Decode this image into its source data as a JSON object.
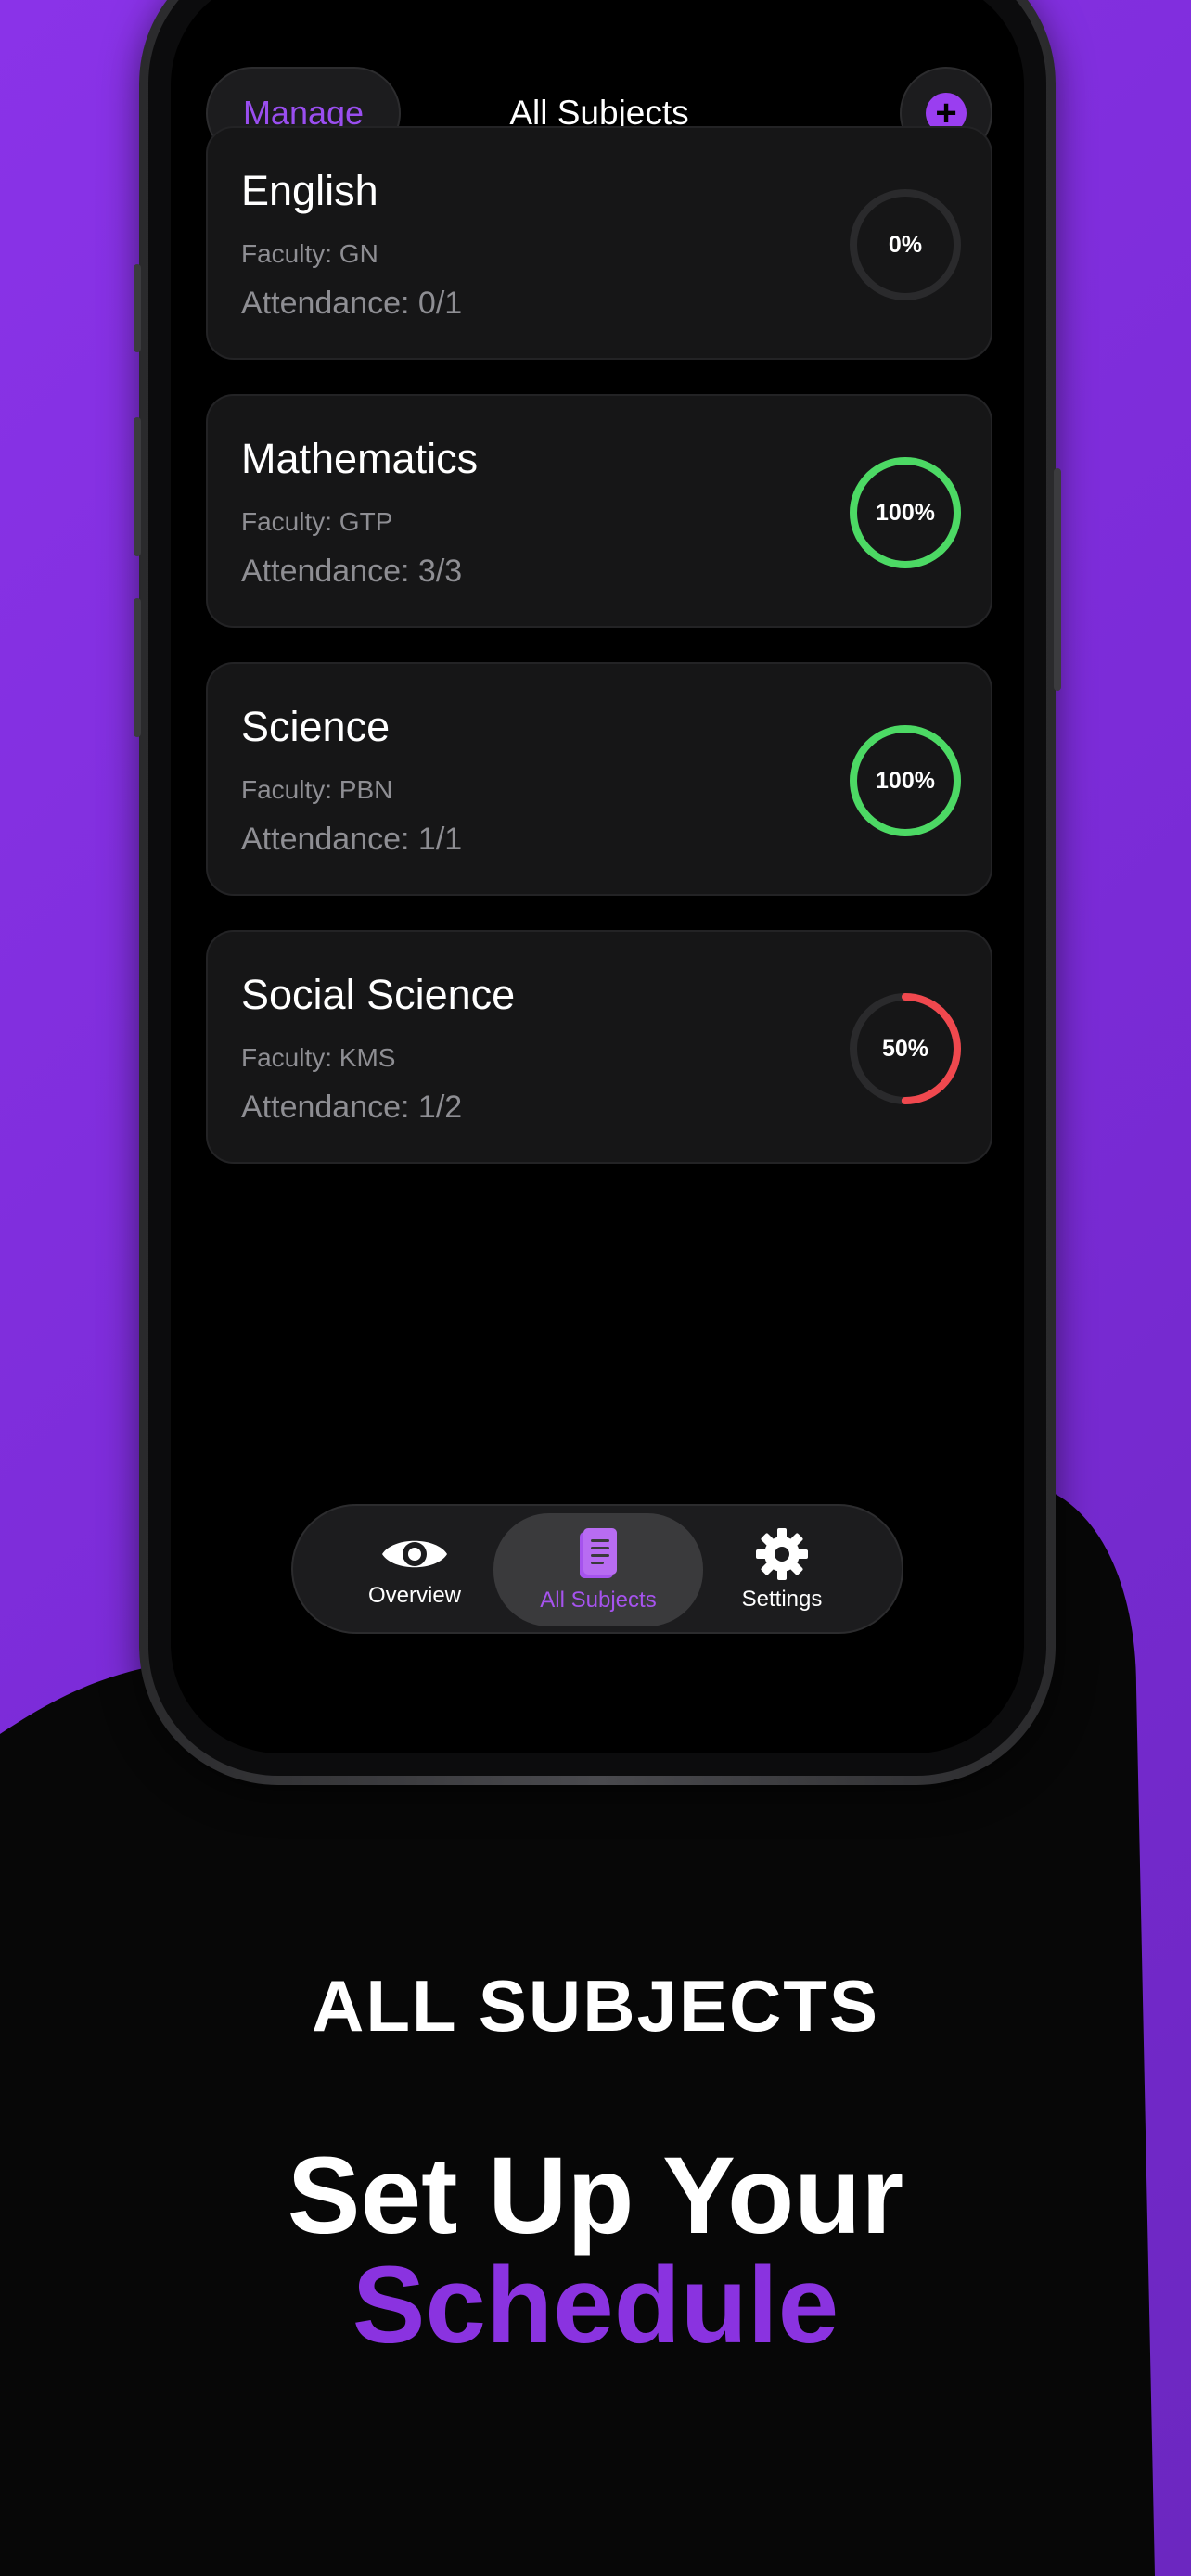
{
  "colors": {
    "accent": "#9a3ef0",
    "ring_full": "#4cd964",
    "ring_half": "#f0484e",
    "ring_track": "#2a2a2c",
    "background": "#7e2fdd"
  },
  "header": {
    "manage_label": "Manage",
    "title": "All Subjects",
    "add_icon": "plus-circle-icon"
  },
  "subjects": [
    {
      "name": "English",
      "faculty": "Faculty: GN",
      "attendance": "Attendance: 0/1",
      "percent_label": "0%",
      "percent": 0
    },
    {
      "name": "Mathematics",
      "faculty": "Faculty: GTP",
      "attendance": "Attendance: 3/3",
      "percent_label": "100%",
      "percent": 100
    },
    {
      "name": "Science",
      "faculty": "Faculty: PBN",
      "attendance": "Attendance: 1/1",
      "percent_label": "100%",
      "percent": 100
    },
    {
      "name": "Social Science",
      "faculty": "Faculty: KMS",
      "attendance": "Attendance: 1/2",
      "percent_label": "50%",
      "percent": 50
    }
  ],
  "tabs": [
    {
      "label": "Overview",
      "icon": "eye-icon",
      "active": false
    },
    {
      "label": "All Subjects",
      "icon": "book-icon",
      "active": true
    },
    {
      "label": "Settings",
      "icon": "gear-icon",
      "active": false
    }
  ],
  "promo": {
    "heading": "ALL SUBJECTS",
    "line1": "Set Up Your",
    "line2": "Schedule"
  }
}
